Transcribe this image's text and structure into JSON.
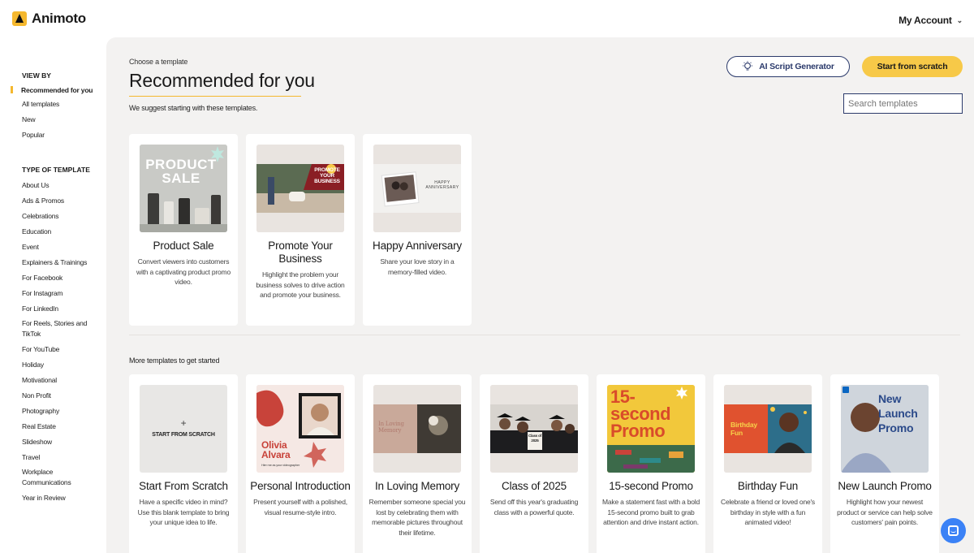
{
  "app": {
    "name": "Animoto",
    "account": "My Account"
  },
  "sidebar": {
    "view_by": "VIEW BY",
    "view_items": [
      "Recommended for you",
      "All templates",
      "New",
      "Popular"
    ],
    "type_heading": "TYPE OF TEMPLATE",
    "type_items": [
      "About Us",
      "Ads & Promos",
      "Celebrations",
      "Education",
      "Event",
      "Explainers & Trainings",
      "For Facebook",
      "For Instagram",
      "For LinkedIn",
      "For Reels, Stories and TikTok",
      "For YouTube",
      "Holiday",
      "Motivational",
      "Non Profit",
      "Photography",
      "Real Estate",
      "Slideshow",
      "Travel",
      "Workplace Communications",
      "Year in Review"
    ]
  },
  "main": {
    "kicker": "Choose a template",
    "title": "Recommended for you",
    "suggest": "We suggest starting with these templates.",
    "ai_button": "AI Script Generator",
    "scratch_button": "Start from scratch",
    "search_placeholder": "Search templates",
    "more_label": "More templates to get started"
  },
  "recommended": [
    {
      "title": "Product Sale",
      "desc": "Convert viewers into customers with a captivating product promo video.",
      "thumb_text": "PRODUCT SALE"
    },
    {
      "title": "Promote Your Business",
      "desc": "Highlight the problem your business solves to drive action and promote your business.",
      "thumb_text": "PROMOTE YOUR BUSINESS"
    },
    {
      "title": "Happy Anniversary",
      "desc": "Share your love story in a memory-filled video.",
      "thumb_text": "HAPPY ANNIVERSARY"
    }
  ],
  "more": [
    {
      "title": "Start From Scratch",
      "desc": "Have a specific video in mind? Use this blank template to bring your unique idea to life.",
      "thumb_text": "START FROM SCRATCH",
      "plus": "+"
    },
    {
      "title": "Personal Introduction",
      "desc": "Present yourself with a polished, visual resume-style intro.",
      "thumb_text": "Olivia Alvara",
      "thumb_sub": "Hire me as your videographer"
    },
    {
      "title": "In Loving Memory",
      "desc": "Remember someone special you lost by celebrating them with memorable pictures throughout their lifetime.",
      "thumb_text": "In Loving Memory"
    },
    {
      "title": "Class of 2025",
      "desc": "Send off this year's graduating class with a powerful quote.",
      "thumb_text": "Class of 2025"
    },
    {
      "title": "15-second Promo",
      "desc": "Make a statement fast with a bold 15-second promo built to grab attention and drive instant action.",
      "thumb_text": "15-second Promo"
    },
    {
      "title": "Birthday Fun",
      "desc": "Celebrate a friend or loved one's birthday in style with a fun animated video!",
      "thumb_text": "Birthday Fun"
    },
    {
      "title": "New Launch Promo",
      "desc": "Highlight how your newest product or service can help solve customers' pain points.",
      "thumb_text": "New Launch Promo"
    }
  ],
  "colors": {
    "accent": "#f5b82e",
    "navy": "#2b3a6b",
    "chat": "#3b82f6"
  }
}
